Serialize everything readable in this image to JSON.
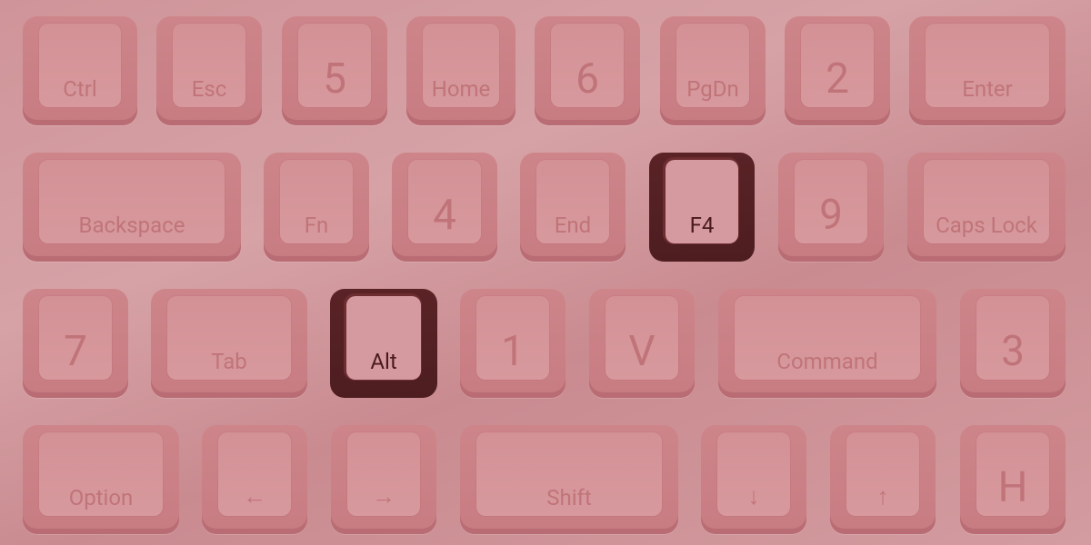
{
  "keyboard": {
    "rows": [
      [
        {
          "name": "key-ctrl",
          "label": "Ctrl",
          "style": "small"
        },
        {
          "name": "key-esc",
          "label": "Esc",
          "style": "small"
        },
        {
          "name": "key-5",
          "label": "5",
          "style": "big"
        },
        {
          "name": "key-home",
          "label": "Home",
          "style": "small"
        },
        {
          "name": "key-6",
          "label": "6",
          "style": "big"
        },
        {
          "name": "key-pgdn",
          "label": "PgDn",
          "style": "small"
        },
        {
          "name": "key-2",
          "label": "2",
          "style": "big"
        },
        {
          "name": "key-enter",
          "label": "Enter",
          "style": "small"
        }
      ],
      [
        {
          "name": "key-backspace",
          "label": "Backspace",
          "style": "small"
        },
        {
          "name": "key-fn",
          "label": "Fn",
          "style": "small"
        },
        {
          "name": "key-4",
          "label": "4",
          "style": "big"
        },
        {
          "name": "key-end",
          "label": "End",
          "style": "small"
        },
        {
          "name": "key-f4",
          "label": "F4",
          "style": "small",
          "active": true
        },
        {
          "name": "key-9",
          "label": "9",
          "style": "big"
        },
        {
          "name": "key-caps-lock",
          "label": "Caps Lock",
          "style": "small"
        }
      ],
      [
        {
          "name": "key-7",
          "label": "7",
          "style": "big"
        },
        {
          "name": "key-tab",
          "label": "Tab",
          "style": "small"
        },
        {
          "name": "key-alt",
          "label": "Alt",
          "style": "small",
          "active": true
        },
        {
          "name": "key-1",
          "label": "1",
          "style": "big"
        },
        {
          "name": "key-v",
          "label": "V",
          "style": "big"
        },
        {
          "name": "key-command",
          "label": "Command",
          "style": "small"
        },
        {
          "name": "key-3",
          "label": "3",
          "style": "big"
        }
      ],
      [
        {
          "name": "key-option",
          "label": "Option",
          "style": "small"
        },
        {
          "name": "key-left-arrow",
          "label": "←",
          "style": "arrow"
        },
        {
          "name": "key-right-arrow",
          "label": "→",
          "style": "arrow"
        },
        {
          "name": "key-shift",
          "label": "Shift",
          "style": "small"
        },
        {
          "name": "key-down-arrow",
          "label": "↓",
          "style": "arrow"
        },
        {
          "name": "key-up-arrow",
          "label": "↑",
          "style": "arrow"
        },
        {
          "name": "key-h",
          "label": "H",
          "style": "big"
        }
      ]
    ]
  },
  "colors": {
    "background": "#d39ca0",
    "key": "#c77c82",
    "key_label": "#c07479",
    "active_key": "#5a2326",
    "active_label": "#4a1a1d"
  }
}
